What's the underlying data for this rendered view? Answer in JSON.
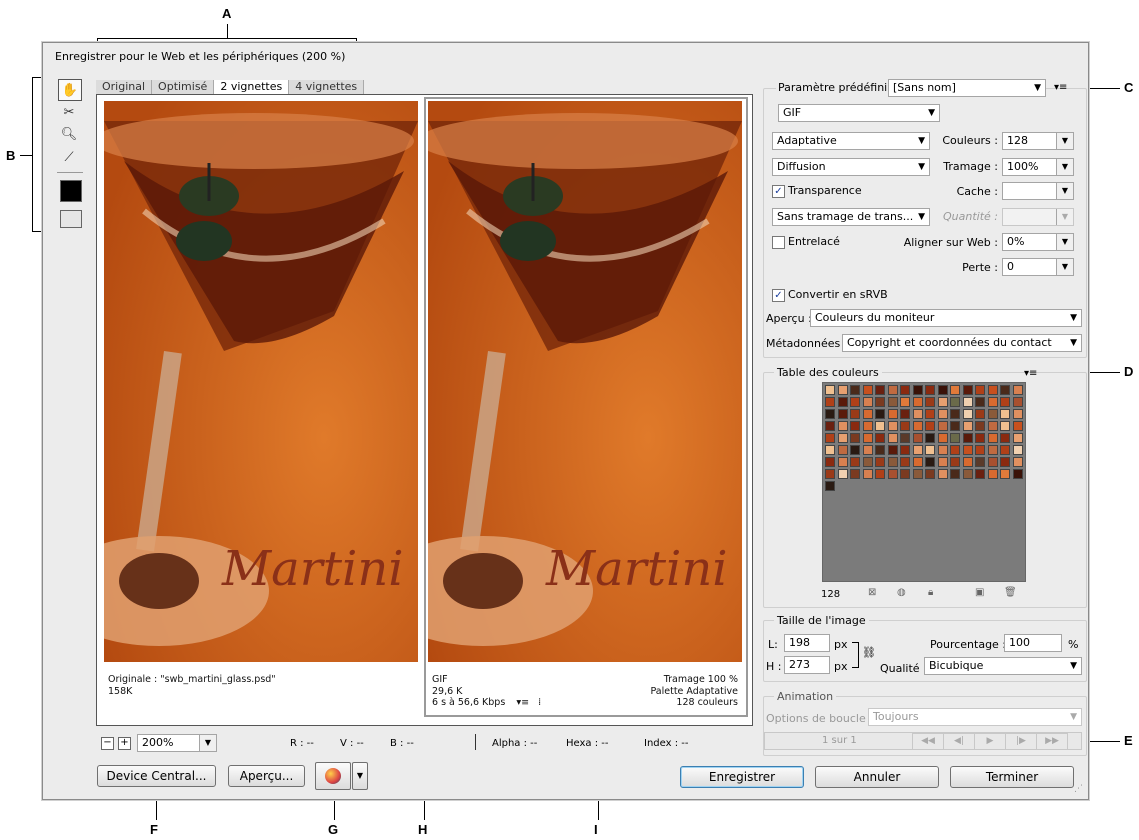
{
  "callouts": [
    "A",
    "B",
    "C",
    "D",
    "E",
    "F",
    "G",
    "H",
    "I"
  ],
  "window": {
    "title": "Enregistrer pour le Web et les périphériques (200 %)"
  },
  "tools": [
    "hand-icon",
    "slice-select-icon",
    "zoom-icon",
    "eyedropper-icon",
    "eyedropper-color-icon",
    "toggle-slices-icon"
  ],
  "tabs": [
    "Original",
    "Optimisé",
    "2 vignettes",
    "4 vignettes"
  ],
  "image_text": "Martini",
  "left_panel": {
    "line1": "Originale : \"swb_martini_glass.psd\"",
    "line2": "158K"
  },
  "right_panel": {
    "format": "GIF",
    "size": "29,6 K",
    "time": "6 s à 56,6 Kbps",
    "dither": "Tramage 100 %",
    "palette": "Palette Adaptative",
    "colors": "128 couleurs"
  },
  "statusbar": {
    "zoom": "200%",
    "r": "R : --",
    "v": "V : --",
    "b": "B : --",
    "alpha": "Alpha : --",
    "hexa": "Hexa : --",
    "index": "Index : --"
  },
  "buttons": {
    "device_central": "Device Central...",
    "preview": "Aperçu...",
    "save": "Enregistrer",
    "cancel": "Annuler",
    "done": "Terminer"
  },
  "settings": {
    "preset_label": "Paramètre prédéfini :",
    "preset_value": "[Sans nom]",
    "format": "GIF",
    "reduction": "Adaptative",
    "colors_label": "Couleurs :",
    "colors_value": "128",
    "dither_algo": "Diffusion",
    "dither_label": "Tramage :",
    "dither_value": "100%",
    "transparency": "Transparence",
    "matte_label": "Cache :",
    "matte_value": "",
    "trans_dither": "Sans tramage de trans...",
    "amount_label": "Quantité :",
    "interlaced": "Entrelacé",
    "websnap_label": "Aligner sur Web :",
    "websnap_value": "0%",
    "lossy_label": "Perte :",
    "lossy_value": "0",
    "convert_srgb": "Convertir en sRVB",
    "preview_label": "Aperçu :",
    "preview_value": "Couleurs du moniteur",
    "metadata_label": "Métadonnées :",
    "metadata_value": "Copyright et coordonnées du contact"
  },
  "color_table": {
    "title": "Table des couleurs",
    "count": "128"
  },
  "image_size": {
    "title": "Taille de l'image",
    "w_label": "L:",
    "w_value": "198",
    "h_label": "H :",
    "h_value": "273",
    "unit": "px",
    "percent_label": "Pourcentage :",
    "percent_value": "100",
    "percent_unit": "%",
    "quality_label": "Qualité :",
    "quality_value": "Bicubique"
  },
  "animation": {
    "title": "Animation",
    "loop_label": "Options de boucle :",
    "loop_value": "Toujours",
    "frame": "1 sur 1"
  }
}
